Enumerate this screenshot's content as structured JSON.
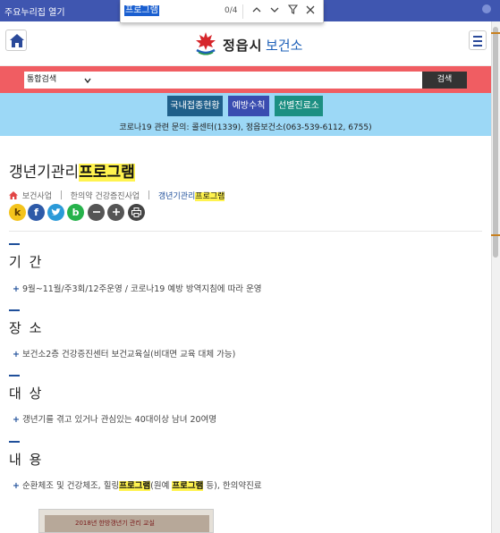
{
  "topbar": {
    "quick_link": "주요누리집 열기"
  },
  "findbar": {
    "query": "프로그램",
    "count": "0/4",
    "up_icon": "chevron-up-icon",
    "down_icon": "chevron-down-icon",
    "filter_icon": "filter-icon",
    "close_icon": "close-icon"
  },
  "header": {
    "logo_city": "정읍시",
    "logo_org": "보건소"
  },
  "search": {
    "scope_selected": "통합검색",
    "input_value": "",
    "button_label": "검색"
  },
  "covid": {
    "buttons": [
      "국내접종현황",
      "예방수칙",
      "선별진료소"
    ],
    "contact": "코로나19 관련 문의: 콜센터(1339), 정읍보건소(063-539-6112, 6755)"
  },
  "page": {
    "title_prefix": "갱년기관리",
    "title_highlight": "프로그램",
    "breadcrumb": {
      "item1": "보건사업",
      "item2": "한의약 건강증진사업",
      "current_prefix": "갱년기관리",
      "current_highlight": "프로그램"
    }
  },
  "share": {
    "k": "k",
    "f": "f",
    "b": "b"
  },
  "sections": {
    "period": {
      "title": "기 간",
      "text": "9월~11월/주3회/12주운영 / 코로나19 예방 방역지침에 따라 운영"
    },
    "place": {
      "title": "장 소",
      "text": "보건소2층 건강증진센터 보건교육실(비대면 교육 대체 가능)"
    },
    "target": {
      "title": "대 상",
      "text": "갱년기를 겪고 있거나 관심있는 40대이상 남녀 20여명"
    },
    "content": {
      "title": "내 용",
      "text_a": "순환체조 및 건강체조, 힐링",
      "text_b": "프로그램",
      "text_c": "(원예 ",
      "text_d": "프로그램",
      "text_e": " 등), 한의약진료"
    }
  },
  "photo": {
    "caption": "2018년 한방갱년기 관리 교실"
  },
  "colors": {
    "topbar": "#3f56b0",
    "search_band": "#f05d62",
    "covid_band": "#9cd8f6",
    "highlight": "#fff34f",
    "accent": "#1f4f9a"
  }
}
